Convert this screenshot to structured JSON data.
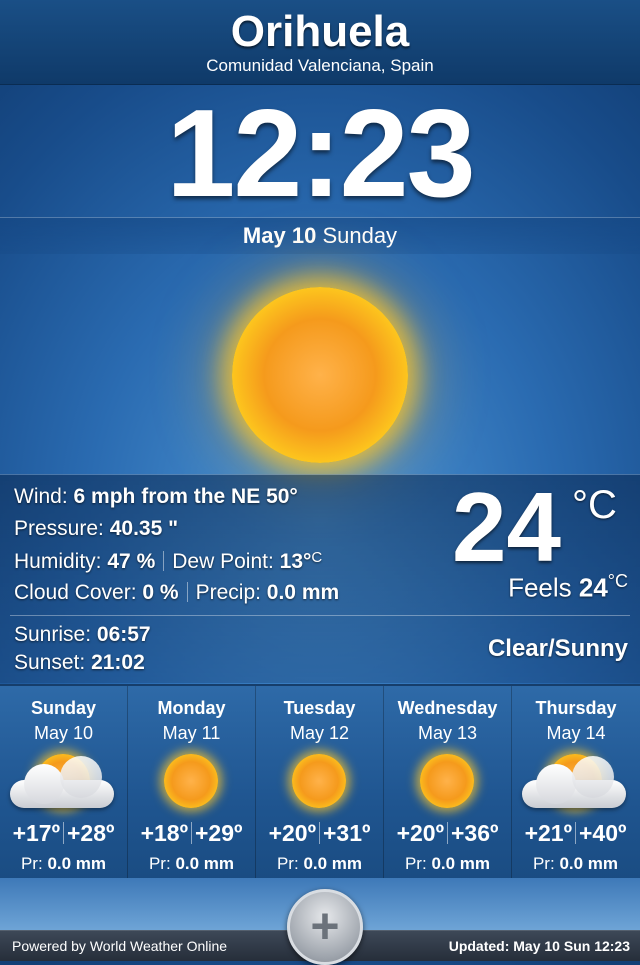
{
  "location": {
    "city": "Orihuela",
    "region": "Comunidad Valenciana, Spain"
  },
  "time": {
    "clock": "12:23",
    "date_bold": "May 10",
    "weekday": "Sunday"
  },
  "current": {
    "wind_label": "Wind:",
    "wind_value": "6 mph from the NE",
    "wind_deg": "50°",
    "pressure_label": "Pressure:",
    "pressure_value": "40.35 \"",
    "humidity_label": "Humidity:",
    "humidity_value": "47 %",
    "dew_label": "Dew Point:",
    "dew_value": "13°",
    "dew_unit": "C",
    "cloud_label": "Cloud Cover:",
    "cloud_value": "0 %",
    "precip_label": "Precip:",
    "precip_value": "0.0 mm",
    "sunrise_label": "Sunrise:",
    "sunrise_value": "06:57",
    "sunset_label": "Sunset:",
    "sunset_value": "21:02",
    "temperature": "24",
    "temp_unit": "°C",
    "feels_label": "Feels",
    "feels_value": "24",
    "feels_unit": "°C",
    "condition": "Clear/Sunny"
  },
  "forecast": [
    {
      "day": "Sunday",
      "date": "May 10",
      "icon": "sun-cloud-icon",
      "low": "+17º",
      "high": "+28º",
      "precip_label": "Pr:",
      "precip": "0.0 mm"
    },
    {
      "day": "Monday",
      "date": "May 11",
      "icon": "sun-icon",
      "low": "+18º",
      "high": "+29º",
      "precip_label": "Pr:",
      "precip": "0.0 mm"
    },
    {
      "day": "Tuesday",
      "date": "May 12",
      "icon": "sun-icon",
      "low": "+20º",
      "high": "+31º",
      "precip_label": "Pr:",
      "precip": "0.0 mm"
    },
    {
      "day": "Wednesday",
      "date": "May 13",
      "icon": "sun-icon",
      "low": "+20º",
      "high": "+36º",
      "precip_label": "Pr:",
      "precip": "0.0 mm"
    },
    {
      "day": "Thursday",
      "date": "May 14",
      "icon": "sun-cloud-icon",
      "low": "+21º",
      "high": "+40º",
      "precip_label": "Pr:",
      "precip": "0.0 mm"
    }
  ],
  "footer": {
    "powered_by": "Powered by World Weather Online",
    "updated": "Updated: May 10 Sun 12:23"
  },
  "colors": {
    "accent": "#2a6bb1",
    "sun": "#f59a1c"
  },
  "icons": {
    "main": "sun-icon",
    "add": "plus-icon"
  }
}
